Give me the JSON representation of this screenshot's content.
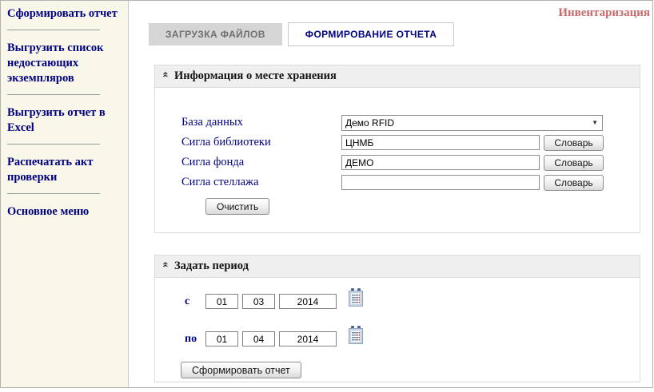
{
  "page": {
    "title": "Инвентаризация"
  },
  "icons": {
    "collapse": "«",
    "select_arrow": "▼"
  },
  "colors": {
    "accent_navy": "#000080",
    "title_red": "#c76b6b",
    "sidebar_bg": "#f9f7ea",
    "panel_header_bg": "#efefef",
    "inactive_tab_bg": "#d5d5d5"
  },
  "sidebar": {
    "items": [
      {
        "label": "Сформировать отчет"
      },
      {
        "label": "Выгрузить список недостающих экземпляров"
      },
      {
        "label": "Выгрузить отчет в Excel"
      },
      {
        "label": "Распечатать акт проверки"
      },
      {
        "label": "Основное меню"
      }
    ]
  },
  "tabs": [
    {
      "label": "ЗАГРУЗКА ФАЙЛОВ",
      "active": false
    },
    {
      "label": "ФОРМИРОВАНИЕ ОТЧЕТА",
      "active": true
    }
  ],
  "storage_panel": {
    "title": "Информация о месте хранения",
    "db_row": {
      "label": "База данных",
      "value": "Демо RFID"
    },
    "rows": [
      {
        "label": "Сигла библиотеки",
        "value": "ЦНМБ",
        "button": "Словарь"
      },
      {
        "label": "Сигла фонда",
        "value": "ДЕМО",
        "button": "Словарь"
      },
      {
        "label": "Сигла стеллажа",
        "value": "",
        "button": "Словарь"
      }
    ],
    "clear_button": "Очистить"
  },
  "period_panel": {
    "title": "Задать период",
    "from": {
      "label": "с",
      "day": "01",
      "month": "03",
      "year": "2014"
    },
    "to": {
      "label": "по",
      "day": "01",
      "month": "04",
      "year": "2014"
    },
    "submit_button": "Сформировать отчет"
  }
}
